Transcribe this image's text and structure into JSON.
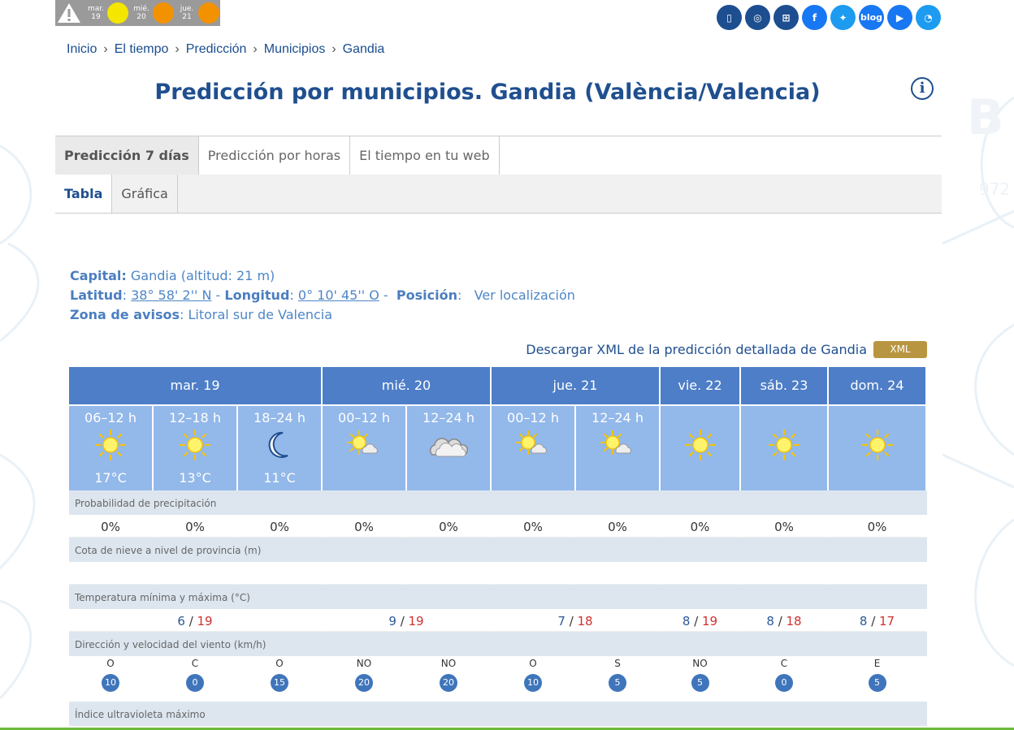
{
  "alerts": [
    {
      "day": "mar.",
      "num": "19",
      "color": "#f5e600"
    },
    {
      "day": "mié.",
      "num": "20",
      "color": "#f39200"
    },
    {
      "day": "jue.",
      "num": "21",
      "color": "#f39200"
    }
  ],
  "social": [
    {
      "name": "mobile-icon",
      "glyph": "▯"
    },
    {
      "name": "satellite-icon",
      "glyph": "◎"
    },
    {
      "name": "sitemap-icon",
      "glyph": "⊞"
    },
    {
      "name": "facebook-icon",
      "glyph": "f"
    },
    {
      "name": "twitter-icon",
      "glyph": "✦"
    },
    {
      "name": "blog-icon",
      "glyph": "blog"
    },
    {
      "name": "youtube-icon",
      "glyph": "▶"
    },
    {
      "name": "rss-icon",
      "glyph": "◔"
    }
  ],
  "breadcrumb": [
    "Inicio",
    "El tiempo",
    "Predicción",
    "Municipios",
    "Gandia"
  ],
  "title": "Predicción por municipios. Gandia (València/Valencia)",
  "tabs": [
    "Predicción 7 días",
    "Predicción por horas",
    "El tiempo en tu web"
  ],
  "subtabs": [
    "Tabla",
    "Gráfica"
  ],
  "meta": {
    "capital_label": "Capital:",
    "capital_value": " Gandia (altitud: 21 m)",
    "lat_label": "Latitud",
    "lat_value": "38° 58' 2'' N",
    "lon_label": "Longitud",
    "lon_value": "0° 10' 45'' O",
    "pos_label": "Posición",
    "pos_link": "Ver localización",
    "zona_label": "Zona de avisos",
    "zona_value": "Litoral sur de Valencia"
  },
  "xml": {
    "text": "Descargar XML de la predicción detallada de Gandia",
    "button": "XML"
  },
  "days": [
    {
      "label": "mar. 19",
      "span": 3
    },
    {
      "label": "mié. 20",
      "span": 2
    },
    {
      "label": "jue. 21",
      "span": 2
    },
    {
      "label": "vie. 22",
      "span": 1
    },
    {
      "label": "sáb. 23",
      "span": 1
    },
    {
      "label": "dom. 24",
      "span": 1
    }
  ],
  "periods": [
    {
      "hours": "06–12 h",
      "icon": "sun",
      "temp": "17°C"
    },
    {
      "hours": "12–18 h",
      "icon": "sun",
      "temp": "13°C"
    },
    {
      "hours": "18–24 h",
      "icon": "moon",
      "temp": "11°C"
    },
    {
      "hours": "00–12 h",
      "icon": "sun-cloud",
      "temp": ""
    },
    {
      "hours": "12–24 h",
      "icon": "cloud",
      "temp": ""
    },
    {
      "hours": "00–12 h",
      "icon": "sun-cloud",
      "temp": ""
    },
    {
      "hours": "12–24 h",
      "icon": "sun-cloud",
      "temp": ""
    },
    {
      "hours": "",
      "icon": "sun",
      "temp": ""
    },
    {
      "hours": "",
      "icon": "sun",
      "temp": ""
    },
    {
      "hours": "",
      "icon": "sun",
      "temp": ""
    }
  ],
  "labels": {
    "precip": "Probabilidad de precipitación",
    "snow": "Cota de nieve a nivel de provincia (m)",
    "temp": "Temperatura mínima y máxima (°C)",
    "wind": "Dirección y velocidad del viento (km/h)",
    "uv": "Índice ultravioleta máximo"
  },
  "precip": [
    "0%",
    "0%",
    "0%",
    "0%",
    "0%",
    "0%",
    "0%",
    "0%",
    "0%",
    "0%"
  ],
  "temps": [
    {
      "min": "6",
      "max": "19"
    },
    {
      "min": "9",
      "max": "19"
    },
    {
      "min": "7",
      "max": "18"
    },
    {
      "min": "8",
      "max": "19"
    },
    {
      "min": "8",
      "max": "18"
    },
    {
      "min": "8",
      "max": "17"
    }
  ],
  "wind": [
    {
      "dir": "O",
      "speed": "10"
    },
    {
      "dir": "C",
      "speed": "0"
    },
    {
      "dir": "O",
      "speed": "15"
    },
    {
      "dir": "NO",
      "speed": "20"
    },
    {
      "dir": "NO",
      "speed": "20"
    },
    {
      "dir": "O",
      "speed": "10"
    },
    {
      "dir": "S",
      "speed": "5"
    },
    {
      "dir": "NO",
      "speed": "5"
    },
    {
      "dir": "C",
      "speed": "0"
    },
    {
      "dir": "E",
      "speed": "5"
    }
  ]
}
